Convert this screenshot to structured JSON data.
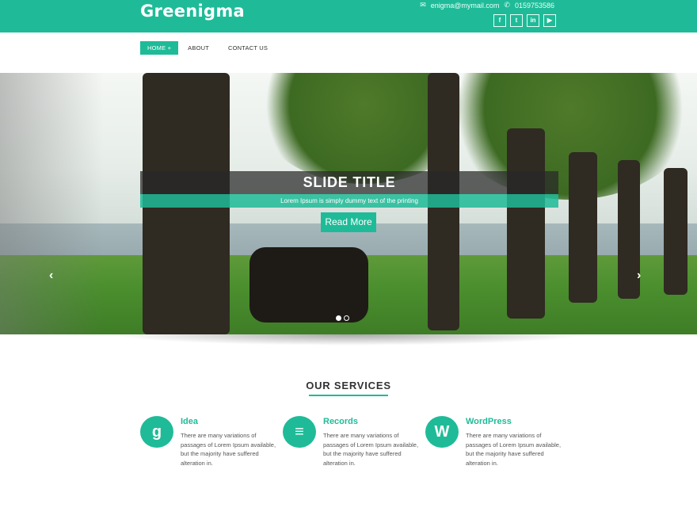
{
  "header": {
    "brand": "Greenigma",
    "email": "enigma@mymail.com",
    "phone": "0159753586",
    "social": [
      {
        "icon": "facebook-icon",
        "glyph": "f"
      },
      {
        "icon": "twitter-icon",
        "glyph": "t"
      },
      {
        "icon": "linkedin-icon",
        "glyph": "in"
      },
      {
        "icon": "youtube-icon",
        "glyph": "▶"
      }
    ]
  },
  "nav": {
    "items": [
      {
        "label": "HOME +",
        "active": true
      },
      {
        "label": "ABOUT",
        "active": false
      },
      {
        "label": "CONTACT US",
        "active": false
      }
    ]
  },
  "slider": {
    "title": "SLIDE TITLE",
    "subtitle": "Lorem Ipsum is simply dummy text of the printing",
    "button": "Read More",
    "prev": "‹",
    "next": "›",
    "dots": 2,
    "active_dot": 0
  },
  "services": {
    "heading": "OUR SERVICES",
    "items": [
      {
        "title": "Idea",
        "icon": "google-icon",
        "glyph": "g",
        "text": "There are many variations of passages of Lorem Ipsum available, but the majority have suffered alteration in."
      },
      {
        "title": "Records",
        "icon": "database-icon",
        "glyph": "≡",
        "text": "There are many variations of passages of Lorem Ipsum available, but the majority have suffered alteration in."
      },
      {
        "title": "WordPress",
        "icon": "wordpress-icon",
        "glyph": "W",
        "text": "There are many variations of passages of Lorem Ipsum available, but the majority have suffered alteration in."
      }
    ]
  },
  "colors": {
    "accent": "#1fbb98"
  }
}
